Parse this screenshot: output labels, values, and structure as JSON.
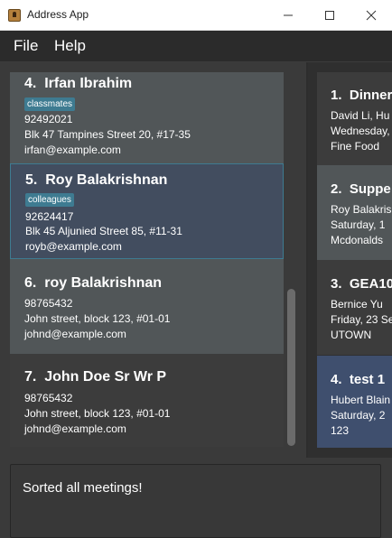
{
  "window": {
    "title": "Address App"
  },
  "menu": {
    "file": "File",
    "help": "Help"
  },
  "persons": [
    {
      "index": "4.",
      "name": "Irfan Ibrahim",
      "tag": "classmates",
      "phone": "92492021",
      "address": "Blk 47 Tampines Street 20, #17-35",
      "email": "irfan@example.com"
    },
    {
      "index": "5.",
      "name": "Roy Balakrishnan",
      "tag": "colleagues",
      "phone": "92624417",
      "address": "Blk 45 Aljunied Street 85, #11-31",
      "email": "royb@example.com"
    },
    {
      "index": "6.",
      "name": "roy Balakrishnan",
      "phone": "98765432",
      "address": "John street, block 123, #01-01",
      "email": "johnd@example.com"
    },
    {
      "index": "7.",
      "name": "John Doe Sr Wr P",
      "phone": "98765432",
      "address": "John street, block 123, #01-01",
      "email": "johnd@example.com"
    }
  ],
  "meetings": [
    {
      "index": "1.",
      "title": "Dinner",
      "line1": "David Li, Hu",
      "line2": "Wednesday,",
      "line3": "Fine Food"
    },
    {
      "index": "2.",
      "title": "Suppe",
      "line1": "Roy Balakris",
      "line2": "Saturday, 1",
      "line3": "Mcdonalds"
    },
    {
      "index": "3.",
      "title": "GEA10",
      "line1": "Bernice Yu",
      "line2": "Friday, 23 Se",
      "line3": "UTOWN"
    },
    {
      "index": "4.",
      "title": "test 1",
      "line1": "Hubert Blain",
      "line2": "Saturday, 2",
      "line3": "123"
    }
  ],
  "result": {
    "text": "Sorted all meetings!"
  },
  "colors": {
    "accent": "#3e7b91",
    "selected_card": "#424d5f",
    "selected_meeting": "#3f4f6e",
    "background": "#3c3c3c"
  }
}
